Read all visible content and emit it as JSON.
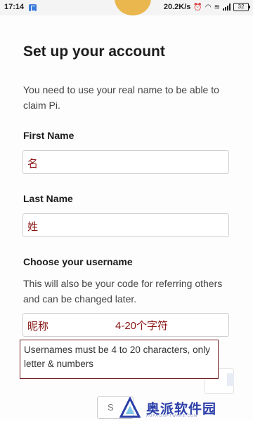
{
  "status_bar": {
    "time": "17:14",
    "speed": "20.2K/s",
    "battery": "32"
  },
  "form": {
    "title": "Set up your account",
    "description": "You need to use your real name to be able to claim Pi.",
    "first_name": {
      "label": "First Name",
      "value": "名"
    },
    "last_name": {
      "label": "Last Name",
      "value": "姓"
    },
    "username": {
      "label": "Choose your username",
      "description": "This will also be your code for referring others and can be changed later.",
      "value": "昵称",
      "hint": "4-20个字符",
      "tooltip": "Usernames must be 4 to 20 characters, only letter & numbers"
    },
    "submit_label": "S"
  },
  "watermark": {
    "text": "奥派软件园",
    "subtext": "AOPAISOFTWARE.COM"
  },
  "colors": {
    "annotation": "#8a1414",
    "watermark": "#2c3fa8",
    "logo": "#e9b74d"
  }
}
